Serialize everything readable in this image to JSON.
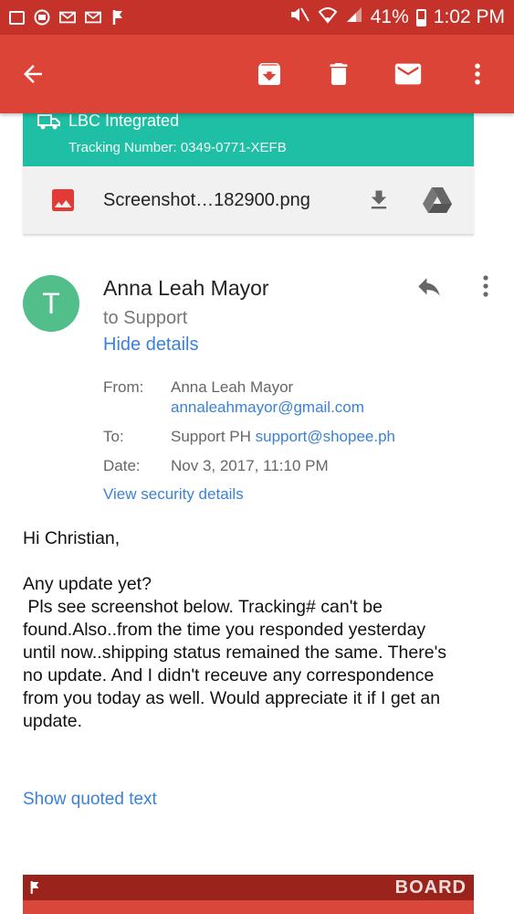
{
  "status_bar": {
    "battery": "41%",
    "time": "1:02 PM"
  },
  "app_bar": {
    "icons": [
      "arrow-back-icon",
      "archive-icon",
      "delete-icon",
      "mail-icon",
      "more-vert-icon"
    ]
  },
  "lbc_card": {
    "title": "LBC Integrated",
    "tracking": "Tracking Number: 0349-0771-XEFB",
    "color": "#1ebfa5"
  },
  "attachment": {
    "filename": "Screenshot…182900.png"
  },
  "message": {
    "avatar_letter": "T",
    "sender": "Anna Leah Mayor",
    "to_summary": "to Support",
    "hide_details": "Hide details",
    "details": {
      "from_label": "From:",
      "from_name": "Anna Leah Mayor",
      "from_email": "annaleahmayor@gmail.com",
      "to_label": "To:",
      "to_name": "Support PH",
      "to_email": "support@shopee.ph",
      "date_label": "Date:",
      "date_value": "Nov 3, 2017, 11:10 PM",
      "security_link": "View security details"
    },
    "body": {
      "greeting": "Hi Christian,",
      "line1": "Any update yet?",
      "line2": " Pls see screenshot below. Tracking# can't be",
      "line3": "found.Also..from the time you responded yesterday",
      "line4": "until now..shipping status remained the same. There's",
      "line5": "no update. And I didn't receuve any correspondence",
      "line6": "from you today as well. Would appreciate it if I get an",
      "line7": "update."
    },
    "show_quoted": "Show quoted text"
  },
  "embedded": {
    "watermark": "BOARD"
  },
  "colors": {
    "status_bar": "#c5322a",
    "app_bar": "#db4437",
    "link": "#3b82d6",
    "avatar": "#52bf8a"
  }
}
